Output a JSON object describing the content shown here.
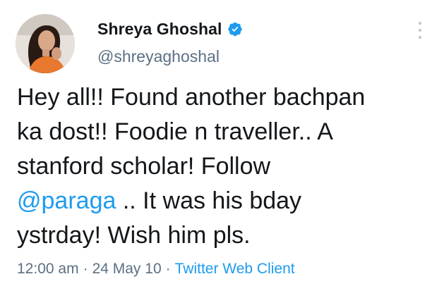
{
  "author": {
    "display_name": "Shreya Ghoshal",
    "handle": "@shreyaghoshal",
    "verified": true
  },
  "tweet": {
    "text_part1": "Hey all!! Found another bachpan\nka dost!! Foodie n traveller.. A\nstanford scholar! Follow\n",
    "mention": "@paraga",
    "text_part2": " .. It was his bday\nystrday! Wish him pls."
  },
  "meta": {
    "time": "12:00 am",
    "separator": "·",
    "date": "24 May 10",
    "source": "Twitter Web Client"
  },
  "colors": {
    "link": "#1d9bf0",
    "secondary_text": "#5b7083",
    "verified_badge": "#1d9bf0"
  },
  "icons": {
    "verified": "verified-badge-icon",
    "more": "more-options-icon"
  }
}
